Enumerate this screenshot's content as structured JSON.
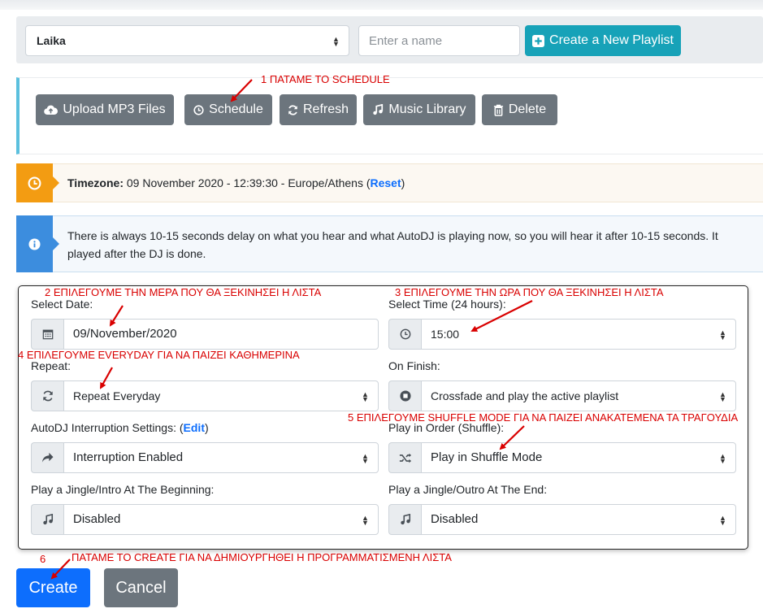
{
  "toolbar": {
    "playlist_select": "Laika",
    "name_placeholder": "Enter a name",
    "create_playlist_label": "Create a New Playlist"
  },
  "actions": {
    "upload": "Upload MP3 Files",
    "schedule": "Schedule",
    "refresh": "Refresh",
    "music_library": "Music Library",
    "delete": "Delete"
  },
  "timezone": {
    "label": "Timezone:",
    "value": " 09 November 2020 - 12:39:30 - Europe/Athens (",
    "reset": "Reset",
    "close": ")"
  },
  "info": {
    "line1": "There is always 10-15 seconds delay on what you hear and what AutoDJ is playing now, so you will hear it after 10-15 seconds. It",
    "line2": "played after the DJ is done."
  },
  "form": {
    "date_label": "Select Date:",
    "date_value": "09/November/2020",
    "time_label": "Select Time (24 hours):",
    "time_value": "15:00",
    "repeat_label": "Repeat:",
    "repeat_value": "Repeat Everyday",
    "finish_label": "On Finish:",
    "finish_value": "Crossfade and play the active playlist",
    "interruption_label": "AutoDJ Interruption Settings: (",
    "interruption_edit": "Edit",
    "interruption_close": ")",
    "interruption_value": "Interruption Enabled",
    "order_label": "Play in Order (Shuffle):",
    "order_value": "Play in Shuffle Mode",
    "jingle_intro_label": "Play a Jingle/Intro At The Beginning:",
    "jingle_intro_value": "Disabled",
    "jingle_outro_label": "Play a Jingle/Outro At The End:",
    "jingle_outro_value": "Disabled"
  },
  "buttons": {
    "create": "Create",
    "cancel": "Cancel"
  },
  "annotations": {
    "a1": "1  ΠΑΤΑΜΕ ΤΟ SCHEDULE",
    "a2": "2     ΕΠΙΛΕΓΟΥΜΕ ΤΗΝ ΜΕΡΑ ΠΟΥ ΘΑ ΞΕΚΙΝΗΣΕΙ Η ΛΙΣΤΑ",
    "a3": "3       ΕΠΙΛΕΓΟΥΜΕ ΤΗΝ ΩΡΑ ΠΟΥ ΘΑ ΞΕΚΙΝΗΣΕΙ Η ΛΙΣΤΑ",
    "a4": "4  ΕΠΙΛΕΓΟΥΜΕ EVERYDAY ΓΙΑ ΝΑ ΠΑΙΖΕΙ ΚΑΘΗΜΕΡΙΝΑ",
    "a5": "5  ΕΠΙΛΕΓΟΥΜΕ SHUFFLE MODE ΓΙΑ ΝΑ ΠΑΙΖΕΙ ΑΝΑΚΑΤΕΜΕΝΑ ΤΑ ΤΡΑΓΟΥΔΙΑ",
    "a6_num": "6",
    "a6": "ΠΑΤΑΜΕ ΤΟ CREATE ΓΙΑ ΝΑ ΔΗΜΙΟΥΡΓΗΘΕΙ Η ΠΡΟΓΡΑΜΜΑΤΙΣΜΕΝΗ ΛΙΣΤΑ"
  },
  "colors": {
    "teal": "#17a2b8",
    "gray_button": "#6c757d",
    "primary": "#0d6efd",
    "timezone_accent": "#f39c12",
    "info_accent": "#3c8dde",
    "annotation": "#d90000"
  }
}
